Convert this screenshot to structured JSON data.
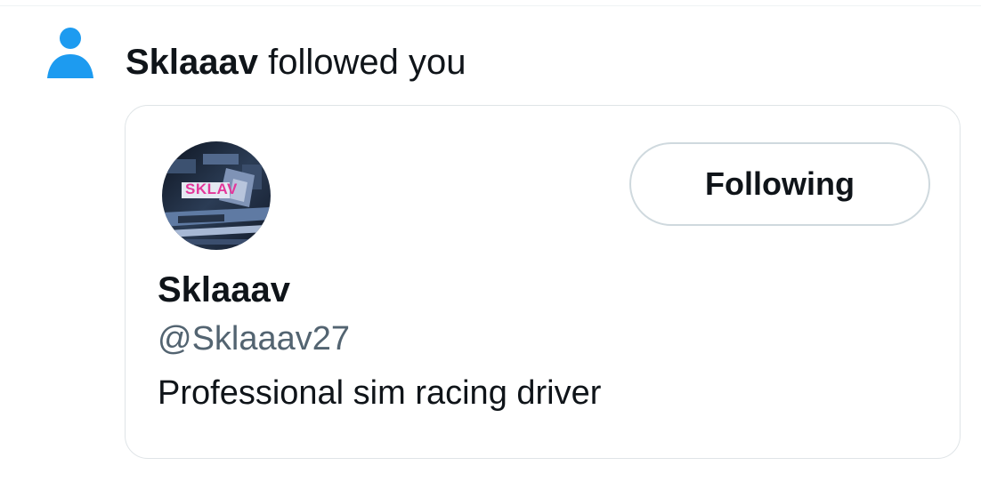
{
  "notification": {
    "actor": "Sklaaav",
    "action": "followed you",
    "icon": "person-icon",
    "icon_color": "#1d9bf0"
  },
  "user_card": {
    "avatar_text": "SKLAV",
    "avatar_text_color": "#e3379a",
    "display_name": "Sklaaav",
    "handle": "@Sklaaav27",
    "bio": "Professional sim racing driver",
    "follow_button_label": "Following"
  }
}
